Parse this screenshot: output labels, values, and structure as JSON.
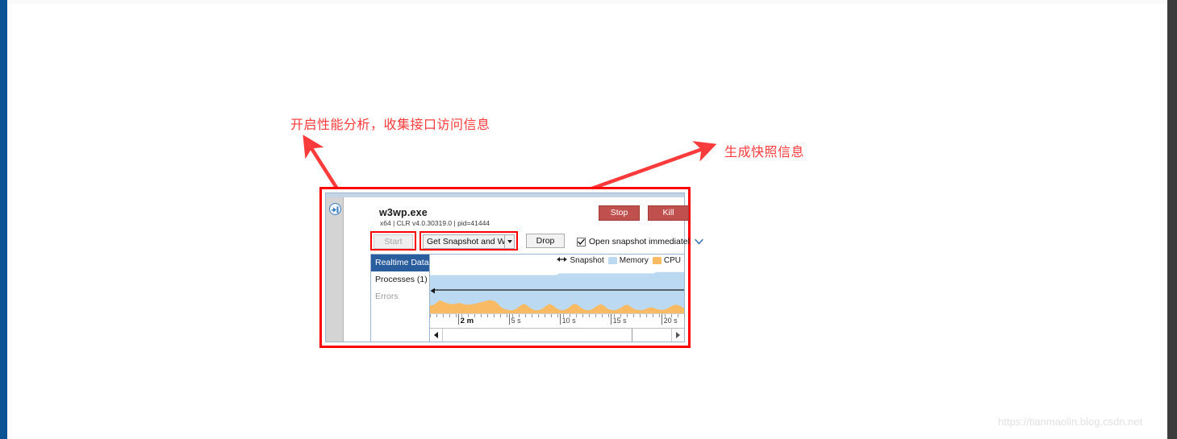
{
  "annotations": {
    "start_note": "开启性能分析，收集接口访问信息",
    "snapshot_note": "生成快照信息",
    "arrow_color": "#fb3b3b",
    "box_color": "#ff0000"
  },
  "panel": {
    "collapse_icon": "collapse-left-icon",
    "process": {
      "name": "w3wp.exe",
      "details": "x64 | CLR v4.0.30319.0 | pid=41444"
    },
    "header_buttons": [
      {
        "label": "Stop",
        "name": "stop-button",
        "color": "#c0504d"
      },
      {
        "label": "Kill",
        "name": "kill-button",
        "color": "#c0504d"
      }
    ],
    "toolbar": {
      "start_label": "Start",
      "start_disabled": true,
      "snapshot_label": "Get Snapshot and Wait",
      "snapshot_caret": "caret-down-icon",
      "drop_label": "Drop",
      "open_snapshot_label": "Open snapshot immediatel",
      "open_snapshot_checked": true,
      "open_snapshot_chevron": "chevron-down-icon"
    },
    "nav": {
      "items": [
        {
          "label": "Realtime Data",
          "selected": true
        },
        {
          "label": "Processes (1)",
          "selected": false
        },
        {
          "label": "Errors",
          "selected": false,
          "dim": true
        }
      ]
    },
    "chart_legend": [
      {
        "label": "Snapshot",
        "icon": "double-arrow-icon",
        "color": "#1a1a1a"
      },
      {
        "label": "Memory",
        "icon": "swatch",
        "color": "#bcd9f2"
      },
      {
        "label": "CPU",
        "icon": "swatch",
        "color": "#f8bb63"
      }
    ],
    "scrollbar": {
      "left_arrow": "scroll-left-arrow-icon",
      "right_arrow": "scroll-right-arrow-icon",
      "thumb_fraction": 0.83
    }
  },
  "chart_data": {
    "type": "area",
    "title": "Realtime Data",
    "xlabel": "",
    "ylabel": "",
    "grid": false,
    "legend_position": "top-right",
    "axis_ticks": [
      {
        "label": "2 m",
        "x_pct": 11,
        "major": true,
        "bold": true
      },
      {
        "label": "5 s",
        "x_pct": 31,
        "major": true,
        "bold": false
      },
      {
        "label": "10 s",
        "x_pct": 51,
        "major": true,
        "bold": false
      },
      {
        "label": "15 s",
        "x_pct": 71,
        "major": true,
        "bold": false
      },
      {
        "label": "20 s",
        "x_pct": 91,
        "major": true,
        "bold": false
      }
    ],
    "minor_tick_count": 40,
    "snapshot_marker_y_pct": 46,
    "series": [
      {
        "name": "Memory",
        "color": "#bcd9f2",
        "values": [
          88,
          88,
          88,
          88,
          88,
          88,
          88,
          88,
          88,
          88,
          88,
          88,
          88,
          88,
          88,
          88,
          88,
          88,
          88,
          88,
          88,
          88,
          88,
          88,
          88,
          88,
          88,
          88,
          88,
          88,
          88,
          88,
          88,
          88,
          88,
          88,
          88,
          88,
          88,
          88,
          92,
          92,
          92,
          92,
          92,
          92,
          92,
          92,
          92,
          92,
          92,
          92,
          92,
          92,
          92,
          92,
          92,
          92,
          92,
          92,
          92,
          92,
          92,
          92,
          92,
          92,
          92,
          92,
          92,
          92,
          95,
          95,
          95,
          95,
          95,
          95,
          95,
          95,
          95,
          95
        ]
      },
      {
        "name": "CPU",
        "color": "#f8bb63",
        "values": [
          18,
          19,
          24,
          30,
          27,
          24,
          22,
          21,
          22,
          24,
          22,
          20,
          20,
          21,
          22,
          24,
          26,
          28,
          30,
          30,
          28,
          22,
          14,
          10,
          8,
          7,
          8,
          12,
          18,
          22,
          18,
          12,
          8,
          7,
          8,
          12,
          18,
          22,
          18,
          12,
          8,
          7,
          9,
          14,
          20,
          22,
          17,
          11,
          8,
          7,
          9,
          14,
          19,
          21,
          16,
          10,
          8,
          7,
          9,
          13,
          18,
          20,
          15,
          10,
          8,
          7,
          8,
          11,
          14,
          13,
          10,
          8,
          8,
          10,
          14,
          18,
          20,
          18,
          14,
          11
        ]
      }
    ]
  },
  "watermark": "https://tianmaolin.blog.csdn.net"
}
